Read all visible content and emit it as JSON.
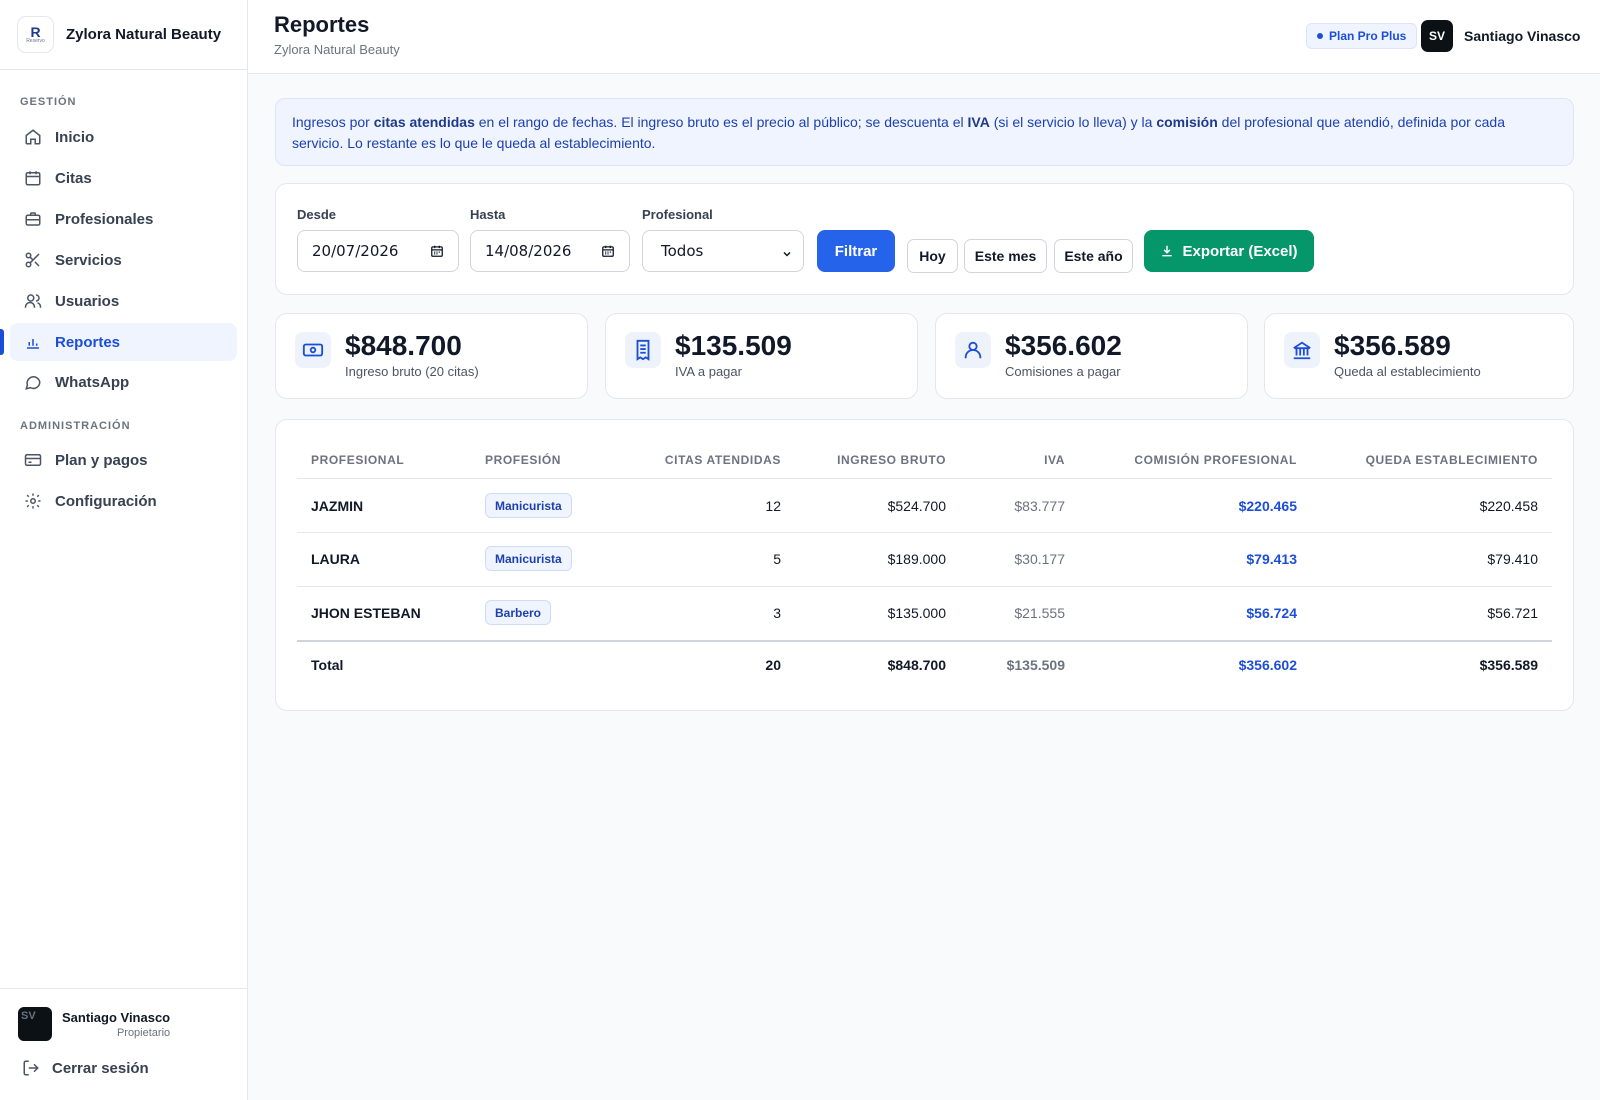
{
  "brand": {
    "name": "Zylora Natural Beauty",
    "logo_letter": "R",
    "logo_sub": "Reservo"
  },
  "sidebar": {
    "section_gestion": "GESTIÓN",
    "section_admin": "ADMINISTRACIÓN",
    "items": [
      {
        "label": "Inicio",
        "icon": "home-icon"
      },
      {
        "label": "Citas",
        "icon": "calendar-icon"
      },
      {
        "label": "Profesionales",
        "icon": "briefcase-icon"
      },
      {
        "label": "Servicios",
        "icon": "scissors-icon"
      },
      {
        "label": "Usuarios",
        "icon": "users-icon"
      },
      {
        "label": "Reportes",
        "icon": "bar-chart-icon",
        "active": true
      },
      {
        "label": "WhatsApp",
        "icon": "chat-bubble-icon"
      },
      {
        "label": "Plan y pagos",
        "icon": "credit-card-icon"
      },
      {
        "label": "Configuración",
        "icon": "gear-icon"
      }
    ],
    "user": {
      "initials": "SV",
      "name": "Santiago Vinasco",
      "role": "Propietario"
    },
    "logout": "Cerrar sesión"
  },
  "header": {
    "title": "Reportes",
    "subtitle": "Zylora Natural Beauty",
    "plan": "Plan Pro Plus",
    "user_initials": "SV",
    "user_name": "Santiago Vinasco"
  },
  "info": {
    "t1": "Ingresos por ",
    "b1": "citas atendidas",
    "t2": " en el rango de fechas. El ingreso bruto es el precio al público; se descuenta el ",
    "b2": "IVA",
    "t3": " (si el servicio lo lleva) y la ",
    "b3": "comisión",
    "t4": " del profesional que atendió, definida por cada servicio. Lo restante es lo que le queda al establecimiento."
  },
  "filters": {
    "desde_label": "Desde",
    "desde_value": "20/07/2026",
    "hasta_label": "Hasta",
    "hasta_value": "14/08/2026",
    "profesional_label": "Profesional",
    "profesional_value": "Todos",
    "filtrar": "Filtrar",
    "hoy": "Hoy",
    "este_mes": "Este mes",
    "este_anio": "Este año",
    "exportar": "Exportar (Excel)"
  },
  "kpis": [
    {
      "value": "$848.700",
      "label": "Ingreso bruto (20 citas)",
      "icon": "cash-icon"
    },
    {
      "value": "$135.509",
      "label": "IVA a pagar",
      "icon": "receipt-icon"
    },
    {
      "value": "$356.602",
      "label": "Comisiones a pagar",
      "icon": "user-icon"
    },
    {
      "value": "$356.589",
      "label": "Queda al establecimiento",
      "icon": "bank-icon"
    }
  ],
  "table": {
    "headers": [
      "PROFESIONAL",
      "PROFESIÓN",
      "CITAS ATENDIDAS",
      "INGRESO BRUTO",
      "IVA",
      "COMISIÓN PROFESIONAL",
      "QUEDA ESTABLECIMIENTO"
    ],
    "rows": [
      {
        "name": "JAZMIN",
        "profesion": "Manicurista",
        "citas": "12",
        "bruto": "$524.700",
        "iva": "$83.777",
        "comision": "$220.465",
        "queda": "$220.458"
      },
      {
        "name": "LAURA",
        "profesion": "Manicurista",
        "citas": "5",
        "bruto": "$189.000",
        "iva": "$30.177",
        "comision": "$79.413",
        "queda": "$79.410"
      },
      {
        "name": "JHON ESTEBAN",
        "profesion": "Barbero",
        "citas": "3",
        "bruto": "$135.000",
        "iva": "$21.555",
        "comision": "$56.724",
        "queda": "$56.721"
      }
    ],
    "total": {
      "label": "Total",
      "citas": "20",
      "bruto": "$848.700",
      "iva": "$135.509",
      "comision": "$356.602",
      "queda": "$356.589"
    }
  }
}
